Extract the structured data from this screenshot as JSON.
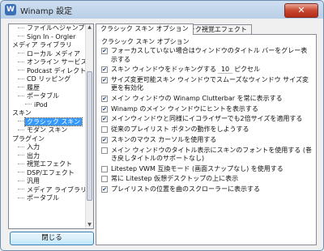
{
  "window": {
    "title": "Winamp 設定",
    "close": "✕"
  },
  "tree": {
    "items": [
      {
        "label": "ファイルヘジャンプ",
        "level": 1,
        "selected": false
      },
      {
        "label": "Sign In - Orgler",
        "level": 1,
        "selected": false
      },
      {
        "label": "メディア ライブラリ",
        "level": 0,
        "selected": false
      },
      {
        "label": "ローカル メディア",
        "level": 1,
        "selected": false
      },
      {
        "label": "オンライン サービス",
        "level": 1,
        "selected": false
      },
      {
        "label": "Podcast ディレクトリ",
        "level": 1,
        "selected": false
      },
      {
        "label": "CD リッピング",
        "level": 1,
        "selected": false
      },
      {
        "label": "履歴",
        "level": 1,
        "selected": false
      },
      {
        "label": "ポータブル",
        "level": 1,
        "selected": false
      },
      {
        "label": "iPod",
        "level": 2,
        "selected": false
      },
      {
        "label": "スキン",
        "level": 0,
        "selected": false
      },
      {
        "label": "クラシック スキン",
        "level": 1,
        "selected": true
      },
      {
        "label": "モダン スキン",
        "level": 1,
        "selected": false
      },
      {
        "label": "プラグイン",
        "level": 0,
        "selected": false
      },
      {
        "label": "入力",
        "level": 1,
        "selected": false
      },
      {
        "label": "出力",
        "level": 1,
        "selected": false
      },
      {
        "label": "視覚エフェクト",
        "level": 1,
        "selected": false
      },
      {
        "label": "DSP/エフェクト",
        "level": 1,
        "selected": false
      },
      {
        "label": "汎用",
        "level": 1,
        "selected": false
      },
      {
        "label": "メディア ライブラリ",
        "level": 1,
        "selected": false
      },
      {
        "label": "ポータブル",
        "level": 1,
        "selected": false
      }
    ]
  },
  "buttons": {
    "close_dialog": "閉じる"
  },
  "tabs": [
    {
      "label": "クラシック スキン オプション",
      "active": true
    },
    {
      "label": "クラシック視覚エフェクト",
      "active": false
    }
  ],
  "group_label": "クラシック スキン オプション",
  "options": [
    {
      "label": "フォーカスしていない場合はウィンドウのタイトル バーをグレー表示する",
      "checked": true
    },
    {
      "label_before": "スキン ウィンドウをドッキングする",
      "value": "10",
      "label_after": "ピクセル",
      "checked": true,
      "has_input": true
    },
    {
      "label": "サイズ変更可能スキン ウィンドウでスムーズなウィンドウ サイズ変更を有効化",
      "checked": true
    },
    {
      "label": "メイン ウィンドウの Winamp Clutterbar を常に表示する",
      "checked": true
    },
    {
      "label": "Winamp のメイン ウィンドウにヒントを表示する",
      "checked": true
    },
    {
      "label": "メインウィンドウと同様にイコライザーでも2倍サイズを適用する",
      "checked": true
    },
    {
      "label": "従来のプレイリスト ボタンの動作をしようする",
      "checked": false
    },
    {
      "label": "スキンのマウス カーソルを使用する",
      "checked": true
    },
    {
      "label": "メイン ウィンドウのタイトル表示にスキンのフォントを使用する (巻き戻しタイトルのサポートなし)",
      "checked": false
    },
    {
      "label": "Litestep VWM 互換モード (画面スナップなし) を使用する",
      "checked": false
    },
    {
      "label": "常に Litestep 仮想デスクトップの上に表示",
      "checked": false
    },
    {
      "label": "プレイリストの位置を曲のスクローラーに表示する",
      "checked": true
    }
  ]
}
